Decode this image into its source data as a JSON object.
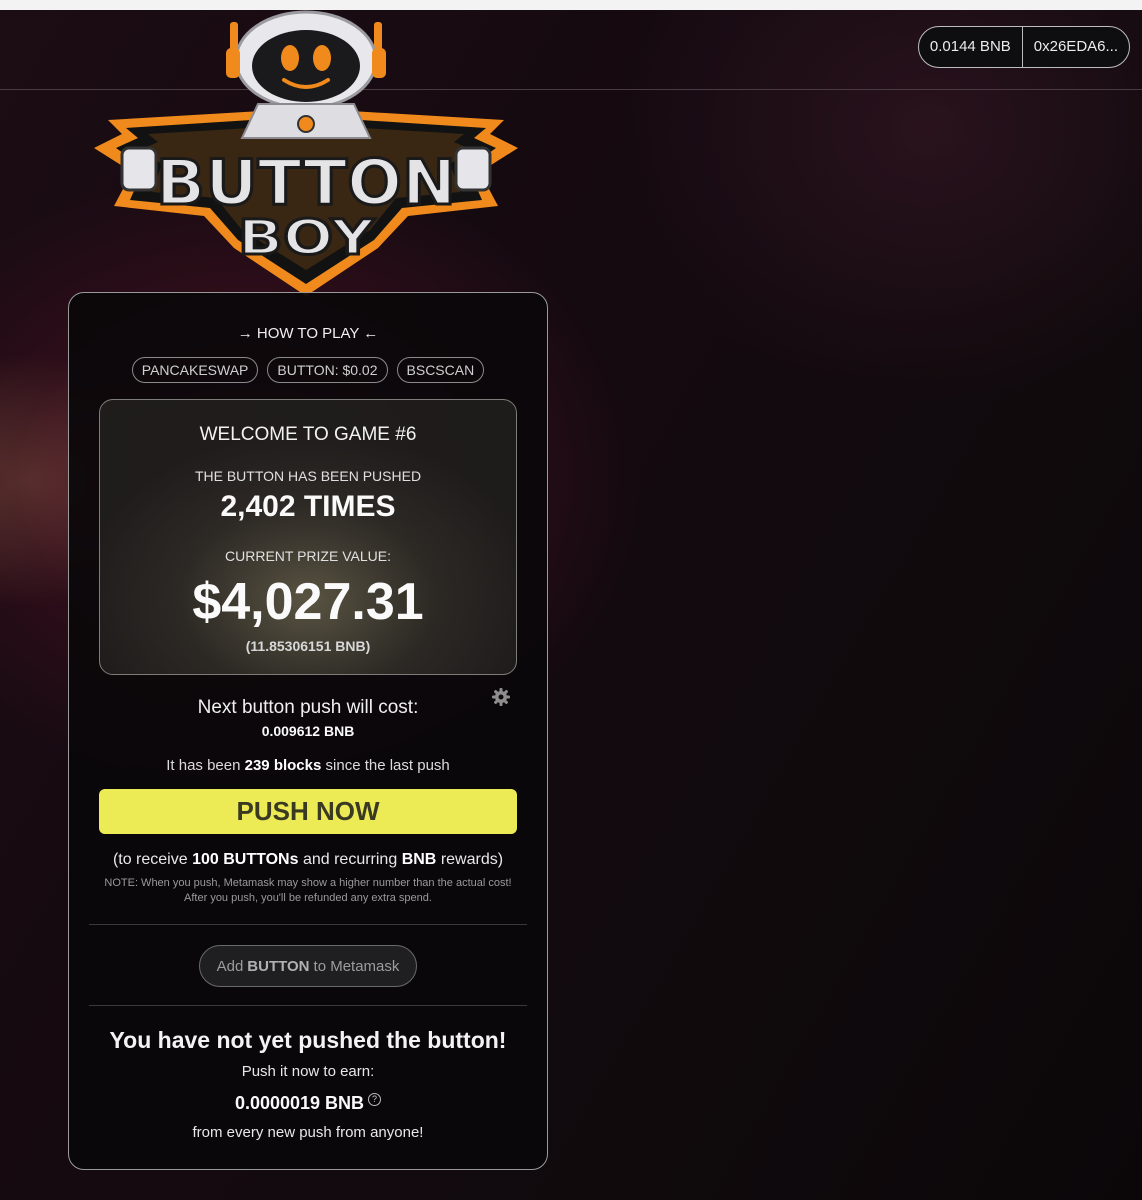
{
  "wallet": {
    "balance": "0.0144 BNB",
    "address": "0x26EDA6..."
  },
  "logo": {
    "line1": "BUTTON",
    "line2": "BOY"
  },
  "panel": {
    "how_to_play": "→ HOW TO PLAY ←",
    "links": [
      "PANCAKESWAP",
      "BUTTON: $0.02",
      "BSCSCAN"
    ],
    "stats": {
      "welcome": "WELCOME TO GAME #6",
      "pushed_label": "THE BUTTON HAS BEEN PUSHED",
      "pushed_times": "2,402 TIMES",
      "prize_label": "CURRENT PRIZE VALUE:",
      "prize_value": "$4,027.31",
      "prize_bnb": "(11.85306151 BNB)"
    },
    "next_cost_label": "Next button push will cost:",
    "next_cost_value": "0.009612 BNB",
    "blocks_prefix": "It has been",
    "blocks_value": "239 blocks",
    "blocks_suffix": "since the last push",
    "push_button": "PUSH NOW",
    "receive_prefix": "(to receive",
    "receive_amount": "100 BUTTONs",
    "receive_mid": "and recurring",
    "receive_token": "BNB",
    "receive_suffix": "rewards)",
    "note_line1": "NOTE: When you push, Metamask may show a higher number than the actual cost!",
    "note_line2": "After you push, you'll be refunded any extra spend.",
    "add_prefix": "Add",
    "add_token": "BUTTON",
    "add_suffix": "to Metamask",
    "not_yet": "You have not yet pushed the button!",
    "push_it": "Push it now to earn:",
    "earn_value": "0.0000019 BNB",
    "help_icon": "?",
    "every_push": "from every new push from anyone!"
  },
  "colors": {
    "push_button": "#ecea55",
    "logo_orange": "#f08a1c"
  }
}
